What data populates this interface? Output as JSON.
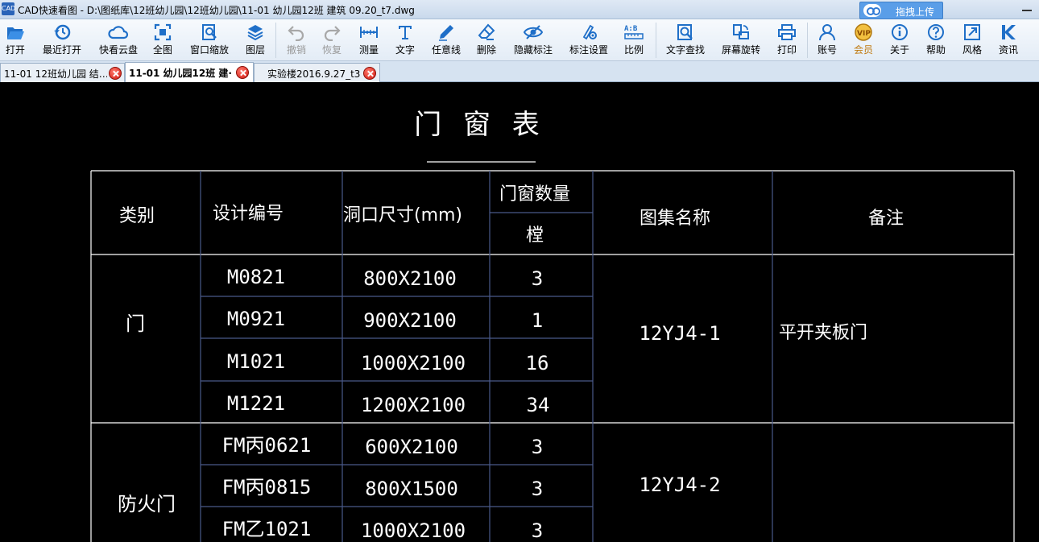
{
  "window": {
    "app_icon": "CAD",
    "title": "CAD快速看图 - D:\\图纸库\\12班幼儿园\\12班幼儿园\\11-01 幼儿园12班 建筑  09.20_t7.dwg",
    "upload_label": "拖拽上传"
  },
  "toolbar": {
    "items": [
      {
        "label": "打开",
        "icon": "folder-open-icon"
      },
      {
        "label": "最近打开",
        "icon": "history-icon"
      },
      {
        "label": "快看云盘",
        "icon": "cloud-icon"
      },
      {
        "label": "全图",
        "icon": "fit-all-icon"
      },
      {
        "label": "窗口缩放",
        "icon": "zoom-window-icon"
      },
      {
        "label": "图层",
        "icon": "layers-icon"
      },
      {
        "label": "撤销",
        "icon": "undo-icon"
      },
      {
        "label": "恢复",
        "icon": "redo-icon"
      },
      {
        "label": "测量",
        "icon": "measure-icon"
      },
      {
        "label": "文字",
        "icon": "text-icon"
      },
      {
        "label": "任意线",
        "icon": "pen-icon"
      },
      {
        "label": "删除",
        "icon": "eraser-icon"
      },
      {
        "label": "隐藏标注",
        "icon": "eye-hide-icon"
      },
      {
        "label": "标注设置",
        "icon": "settings-icon"
      },
      {
        "label": "比例",
        "icon": "scale-icon"
      },
      {
        "label": "文字查找",
        "icon": "text-search-icon"
      },
      {
        "label": "屏幕旋转",
        "icon": "rotate-icon"
      },
      {
        "label": "打印",
        "icon": "printer-icon"
      },
      {
        "label": "账号",
        "icon": "user-icon"
      },
      {
        "label": "会员",
        "icon": "vip-icon"
      },
      {
        "label": "关于",
        "icon": "info-icon"
      },
      {
        "label": "帮助",
        "icon": "help-icon"
      },
      {
        "label": "风格",
        "icon": "style-icon"
      },
      {
        "label": "资讯",
        "icon": "news-icon"
      }
    ]
  },
  "tabs": [
    {
      "label": "11-01 12班幼儿园 结…"
    },
    {
      "label": "11-01 幼儿园12班 建·"
    },
    {
      "label": "实验楼2016.9.27_t3"
    }
  ],
  "drawing": {
    "title": "门 窗 表",
    "headers": {
      "category": "类别",
      "design_no": "设计编号",
      "opening_size": "洞口尺寸(mm)",
      "quantity": "门窗数量",
      "quantity_unit": "樘",
      "atlas": "图集名称",
      "remark": "备注"
    },
    "groups": [
      {
        "category": "门",
        "atlas": "12YJ4-1",
        "remark": "平开夹板门",
        "rows": [
          {
            "code": "M0821",
            "size": "800X2100",
            "qty": "3"
          },
          {
            "code": "M0921",
            "size": "900X2100",
            "qty": "1"
          },
          {
            "code": "M1021",
            "size": "1000X2100",
            "qty": "16"
          },
          {
            "code": "M1221",
            "size": "1200X2100",
            "qty": "34"
          }
        ]
      },
      {
        "category": "防火门",
        "atlas": "12YJ4-2",
        "remark": "",
        "rows": [
          {
            "code": "FM丙0621",
            "size": "600X2100",
            "qty": "3"
          },
          {
            "code": "FM丙0815",
            "size": "800X1500",
            "qty": "3"
          },
          {
            "code": "FM乙1021",
            "size": "1000X2100",
            "qty": "3"
          }
        ]
      }
    ]
  },
  "colors": {
    "background": "#000000",
    "table_line": "#ffffff",
    "inner_line": "#4a5a8a",
    "vip_text": "#c07a10"
  }
}
